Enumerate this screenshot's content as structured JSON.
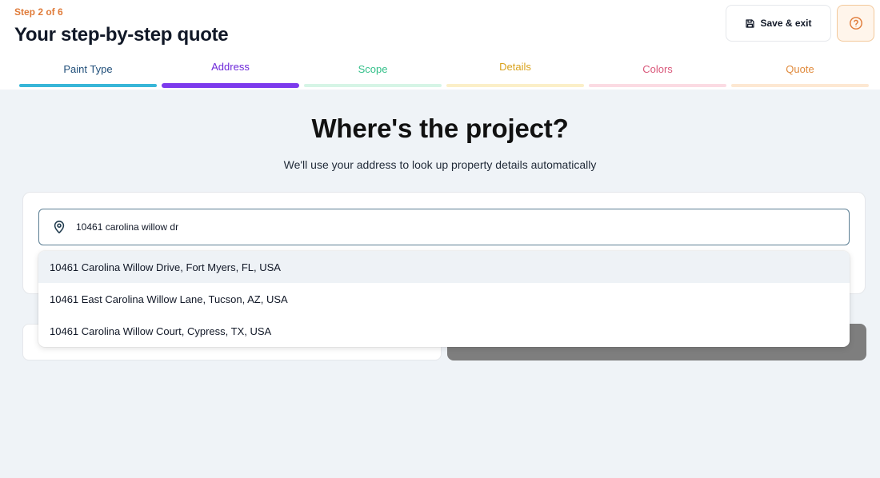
{
  "header": {
    "step_label": "Step 2 of 6",
    "title": "Your step-by-step quote",
    "save_exit_label": "Save & exit"
  },
  "tabs": [
    {
      "label": "Paint Type",
      "color": "#1f4e79",
      "bar_color": "#38b6d8",
      "active": false
    },
    {
      "label": "Address",
      "color": "#6d28d9",
      "bar_color": "#7c3aed",
      "active": true
    },
    {
      "label": "Scope",
      "color": "#34c08a",
      "bar_color": "#d6f5e6",
      "active": false
    },
    {
      "label": "Details",
      "color": "#d9a21b",
      "bar_color": "#fbefc8",
      "active": false
    },
    {
      "label": "Colors",
      "color": "#d9577a",
      "bar_color": "#fbdbe3",
      "active": false
    },
    {
      "label": "Quote",
      "color": "#e08a3c",
      "bar_color": "#fde8d2",
      "active": false
    }
  ],
  "main": {
    "heading": "Where's the project?",
    "subheading": "We'll use your address to look up property details automatically"
  },
  "search": {
    "value": "10461 carolina willow dr",
    "icon": "location-pin-icon"
  },
  "suggestions": [
    "10461 Carolina Willow Drive, Fort Myers, FL, USA",
    "10461 East Carolina Willow Lane, Tucson, AZ, USA",
    "10461 Carolina Willow Court, Cypress, TX, USA"
  ],
  "colors": {
    "accent_orange": "#e07b39",
    "page_bg": "#eff3f7",
    "input_border": "#5b7e93",
    "disabled_button": "#7e7e7e"
  }
}
